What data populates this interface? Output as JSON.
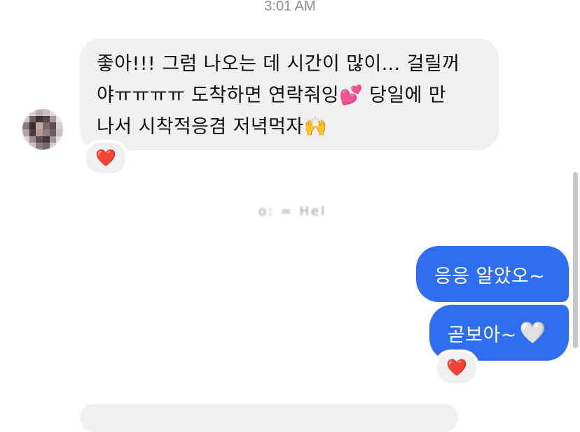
{
  "timestamp": "3:01 AM",
  "incoming_message": {
    "lines": [
      "좋아!!! 그럼 나오는 데 시간이 많이... 걸릴꺼",
      "야ㅠㅠㅠㅠ 도착하면 연락줘잉💕 당일에 만",
      "나서 시착적응겸 저녁먹자🙌"
    ],
    "reaction": "❤️"
  },
  "sender_name": "o: = Hel",
  "outgoing_messages": [
    {
      "text": "응응 알았오~"
    },
    {
      "text": "곧보아~",
      "emoji": "🤍",
      "reaction": "❤️"
    }
  ],
  "colors": {
    "incoming_bubble": "#f0f0f2",
    "outgoing_bubble": "#2f6fef",
    "reaction_heart": "#e0202a"
  }
}
